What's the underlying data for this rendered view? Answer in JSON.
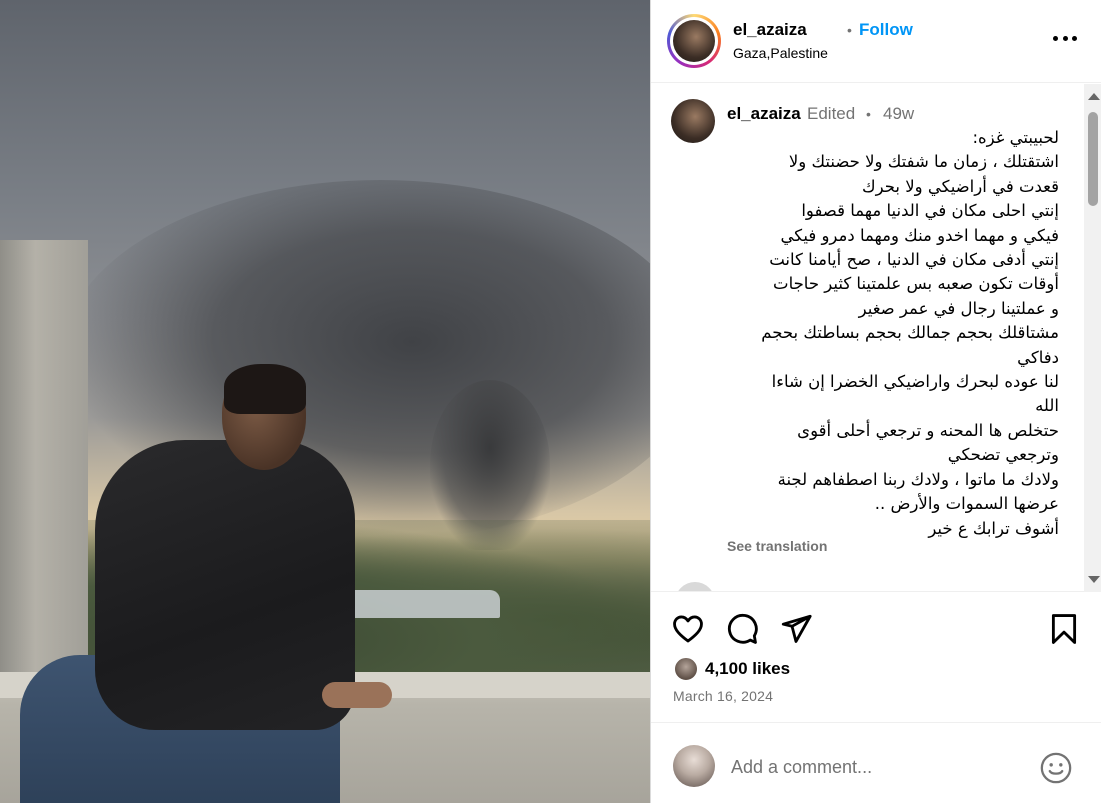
{
  "post": {
    "photo_alt": "",
    "header": {
      "username": "el_azaiza",
      "separator": "•",
      "follow_label": "Follow",
      "location": "Gaza,Palestine"
    },
    "caption": {
      "username": "el_azaiza",
      "edited": "Edited",
      "separator": "•",
      "time": "49w",
      "lines": [
        "لحبيبتي غزه:",
        "اشتقتلك ، زمان ما شفتك ولا حضنتك ولا",
        "قعدت في أراضيكي ولا بحرك",
        "إنتي احلى مكان في الدنيا مهما قصفوا",
        "فيكي و مهما اخدو منك ومهما دمرو فيكي",
        "إنتي أدفى مكان في الدنيا ، صح أيامنا كانت",
        "أوقات تكون صعبه بس علمتينا كثير حاجات",
        "و عملتينا رجال في عمر صغير",
        "مشتاقلك بحجم جمالك بحجم بساطتك بحجم",
        "دفاكي",
        "لنا عوده لبحرك واراضيكي الخضرا إن شاءا",
        "الله",
        "حتخلص ها المحنه و ترجعي أحلى أقوى",
        "وترجعي تضحكي",
        "ولادك ما ماتوا ، ولادك ربنا اصطفاهم لجنة",
        "عرضها السموات والأرض ..",
        "أشوف ترابك ع خير"
      ],
      "see_translation": "See translation",
      "next_comment_preview": "..."
    },
    "icons": {
      "like": "heart-icon",
      "comment": "comment-icon",
      "share": "send-icon",
      "save": "bookmark-icon",
      "more": "more-horizontal-icon",
      "emoji": "smiley-icon"
    },
    "likes": "4,100 likes",
    "date": "March 16, 2024",
    "comment_input": {
      "placeholder": "Add a comment...",
      "value": ""
    },
    "colors": {
      "follow": "#0095f6",
      "secondary_text": "#737373",
      "border": "#efefef"
    }
  }
}
